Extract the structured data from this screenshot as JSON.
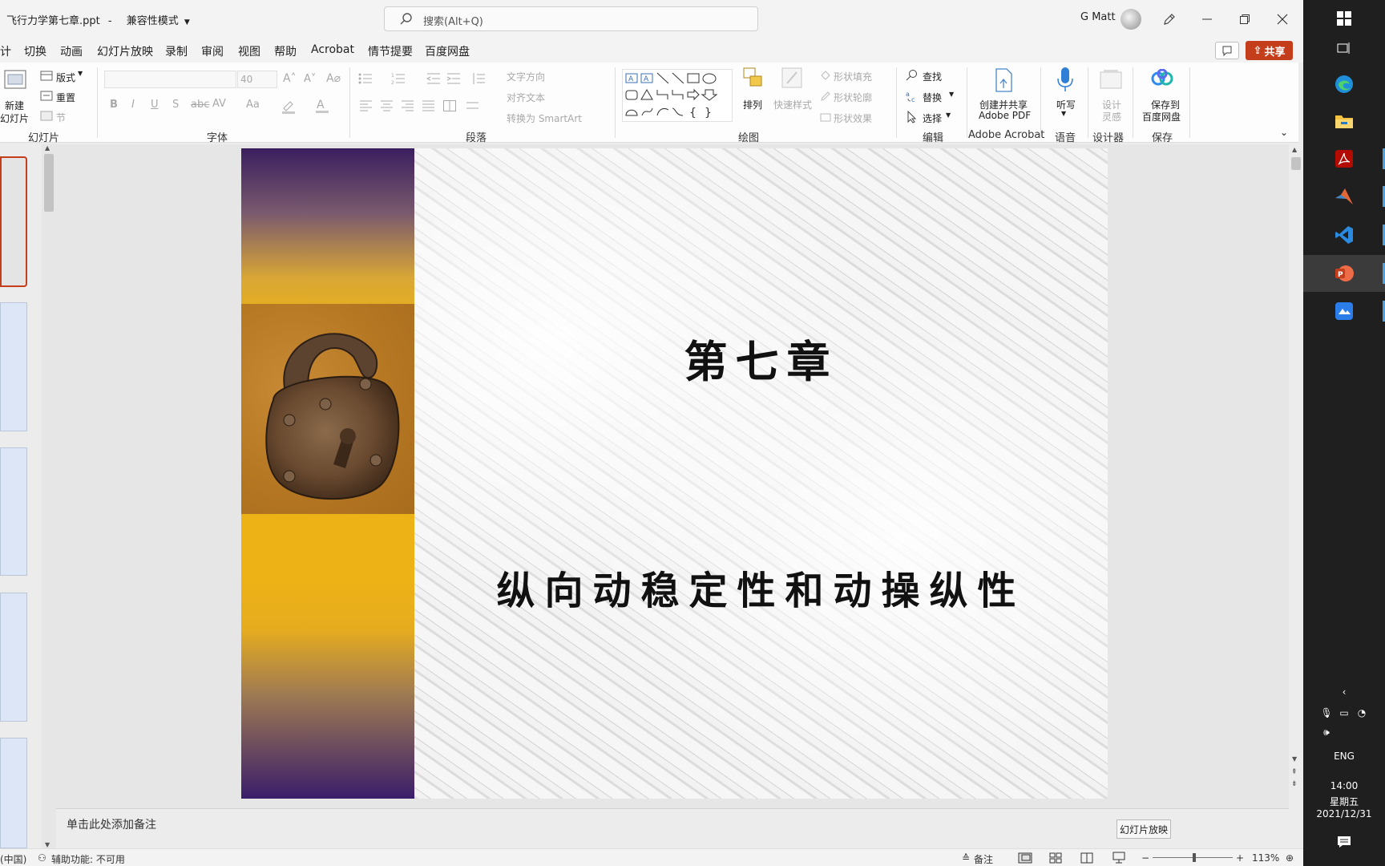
{
  "window": {
    "doc_title": "飞行力学第七章.ppt",
    "separator": "-",
    "mode": "兼容性模式",
    "search_placeholder": "搜索(Alt+Q)",
    "user_name": "G Matt"
  },
  "menu": {
    "tabs": [
      "计",
      "切换",
      "动画",
      "幻灯片放映",
      "录制",
      "审阅",
      "视图",
      "帮助",
      "Acrobat",
      "情节提要",
      "百度网盘"
    ],
    "share_label": "共享"
  },
  "ribbon": {
    "slides_group": {
      "new_slide_line1": "新建",
      "new_slide_line2": "幻灯片",
      "layout": "版式",
      "reset": "重置",
      "section": "节",
      "label": "幻灯片"
    },
    "font_group": {
      "size": "40",
      "label": "字体"
    },
    "paragraph_group": {
      "text_direction": "文字方向",
      "align_text": "对齐文本",
      "convert_smartart": "转换为 SmartArt",
      "label": "段落"
    },
    "drawing_group": {
      "arrange": "排列",
      "quick_styles": "快速样式",
      "shape_fill": "形状填充",
      "shape_outline": "形状轮廓",
      "shape_effects": "形状效果",
      "label": "绘图"
    },
    "editing_group": {
      "find": "查找",
      "replace": "替换",
      "select": "选择",
      "label": "编辑"
    },
    "acrobat_group": {
      "create_line1": "创建并共享",
      "create_line2": "Adobe PDF",
      "label": "Adobe Acrobat"
    },
    "voice_group": {
      "dictate": "听写",
      "label": "语音"
    },
    "designer_group": {
      "design_line1": "设计",
      "design_line2": "灵感",
      "label": "设计器"
    },
    "save_group": {
      "save_line1": "保存到",
      "save_line2": "百度网盘",
      "label": "保存"
    }
  },
  "slide": {
    "title": "第七章",
    "subtitle": "纵向动稳定性和动操纵性"
  },
  "notes": {
    "placeholder": "单击此处添加备注"
  },
  "slideshow_tooltip": "幻灯片放映",
  "status": {
    "language": "(中国)",
    "accessibility": "辅助功能: 不可用",
    "notes_btn": "备注",
    "zoom": "113%"
  },
  "taskbar": {
    "language": "ENG",
    "time": "14:00",
    "weekday": "星期五",
    "date": "2021/12/31"
  },
  "colors": {
    "share": "#c43e1c",
    "taskbar": "#1f1f1f",
    "accent": "#4f9fd8"
  }
}
